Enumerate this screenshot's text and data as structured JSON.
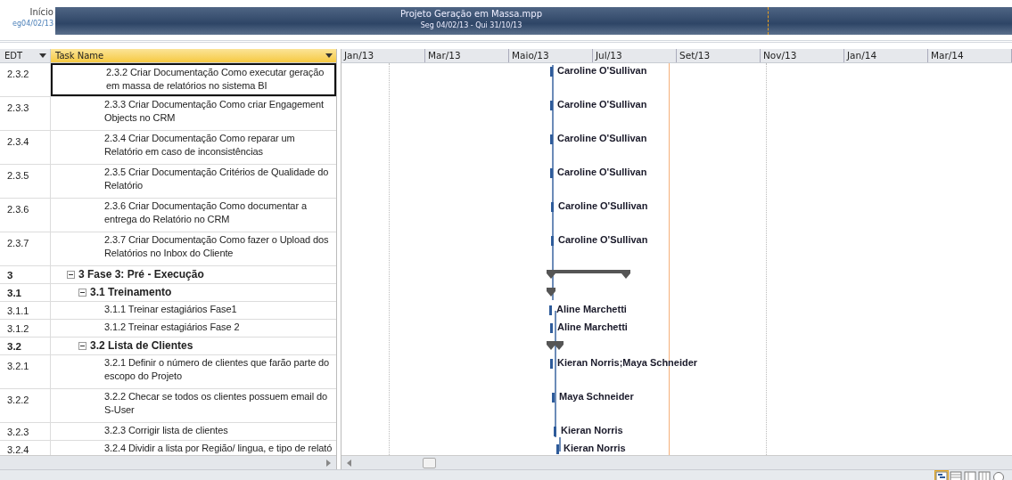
{
  "timeline": {
    "start_label": "Início",
    "start_date": "eg04/02/13",
    "title": "Projeto Geração em Massa.mpp",
    "date_range": "Seg 04/02/13 - Qui 31/10/13"
  },
  "table": {
    "columns": [
      "EDT",
      "Task Name"
    ],
    "rows": [
      {
        "edt": "2.3.2",
        "name": "2.3.2 Criar Documentação Como executar geração em massa de relatórios no sistema BI",
        "kind": "task",
        "selected": true,
        "resource": "Caroline O'Sullivan"
      },
      {
        "edt": "2.3.3",
        "name": "2.3.3 Criar Documentação Como criar Engagement Objects no CRM",
        "kind": "task",
        "selected": false,
        "resource": "Caroline O'Sullivan"
      },
      {
        "edt": "2.3.4",
        "name": "2.3.4 Criar Documentação Como reparar um Relatório em caso de inconsistências",
        "kind": "task",
        "selected": false,
        "resource": "Caroline O'Sullivan"
      },
      {
        "edt": "2.3.5",
        "name": "2.3.5 Criar Documentação Critérios de Qualidade do Relatório",
        "kind": "task",
        "selected": false,
        "resource": "Caroline O'Sullivan"
      },
      {
        "edt": "2.3.6",
        "name": "2.3.6 Criar Documentação Como documentar a entrega do Relatório no CRM",
        "kind": "task",
        "selected": false,
        "resource": "Caroline O'Sullivan"
      },
      {
        "edt": "2.3.7",
        "name": "2.3.7 Criar Documentação Como fazer o Upload dos Relatórios no Inbox do Cliente",
        "kind": "task",
        "selected": false,
        "resource": "Caroline O'Sullivan"
      },
      {
        "edt": "3",
        "name": "3 Fase 3: Pré - Execução",
        "kind": "summary",
        "expanded": true,
        "selected": false
      },
      {
        "edt": "3.1",
        "name": "3.1 Treinamento",
        "kind": "summary",
        "expanded": true,
        "selected": false
      },
      {
        "edt": "3.1.1",
        "name": "3.1.1 Treinar estagiários Fase1",
        "kind": "task",
        "selected": false,
        "resource": "Aline Marchetti"
      },
      {
        "edt": "3.1.2",
        "name": "3.1.2 Treinar estagiários Fase 2",
        "kind": "task",
        "selected": false,
        "resource": "Aline Marchetti"
      },
      {
        "edt": "3.2",
        "name": "3.2 Lista de Clientes",
        "kind": "summary",
        "expanded": true,
        "selected": false
      },
      {
        "edt": "3.2.1",
        "name": "3.2.1 Definir o número de clientes que farão parte do escopo do Projeto",
        "kind": "task",
        "selected": false,
        "resource": "Kieran Norris;Maya Schneider"
      },
      {
        "edt": "3.2.2",
        "name": "3.2.2 Checar se todos os clientes possuem email do S-User",
        "kind": "task",
        "selected": false,
        "resource": "Maya Schneider"
      },
      {
        "edt": "3.2.3",
        "name": "3.2.3 Corrigir lista de clientes",
        "kind": "task",
        "selected": false,
        "resource": "Kieran Norris"
      },
      {
        "edt": "3.2.4",
        "name": "3.2.4 Dividir a lista por Região/ lingua, e tipo de relató",
        "kind": "task",
        "selected": false,
        "resource": "Kieran Norris"
      }
    ]
  },
  "gantt": {
    "timescale": [
      "Jan/13",
      "Mar/13",
      "Maio/13",
      "Jul/13",
      "Set/13",
      "Nov/13",
      "Jan/14",
      "Mar/14"
    ]
  }
}
